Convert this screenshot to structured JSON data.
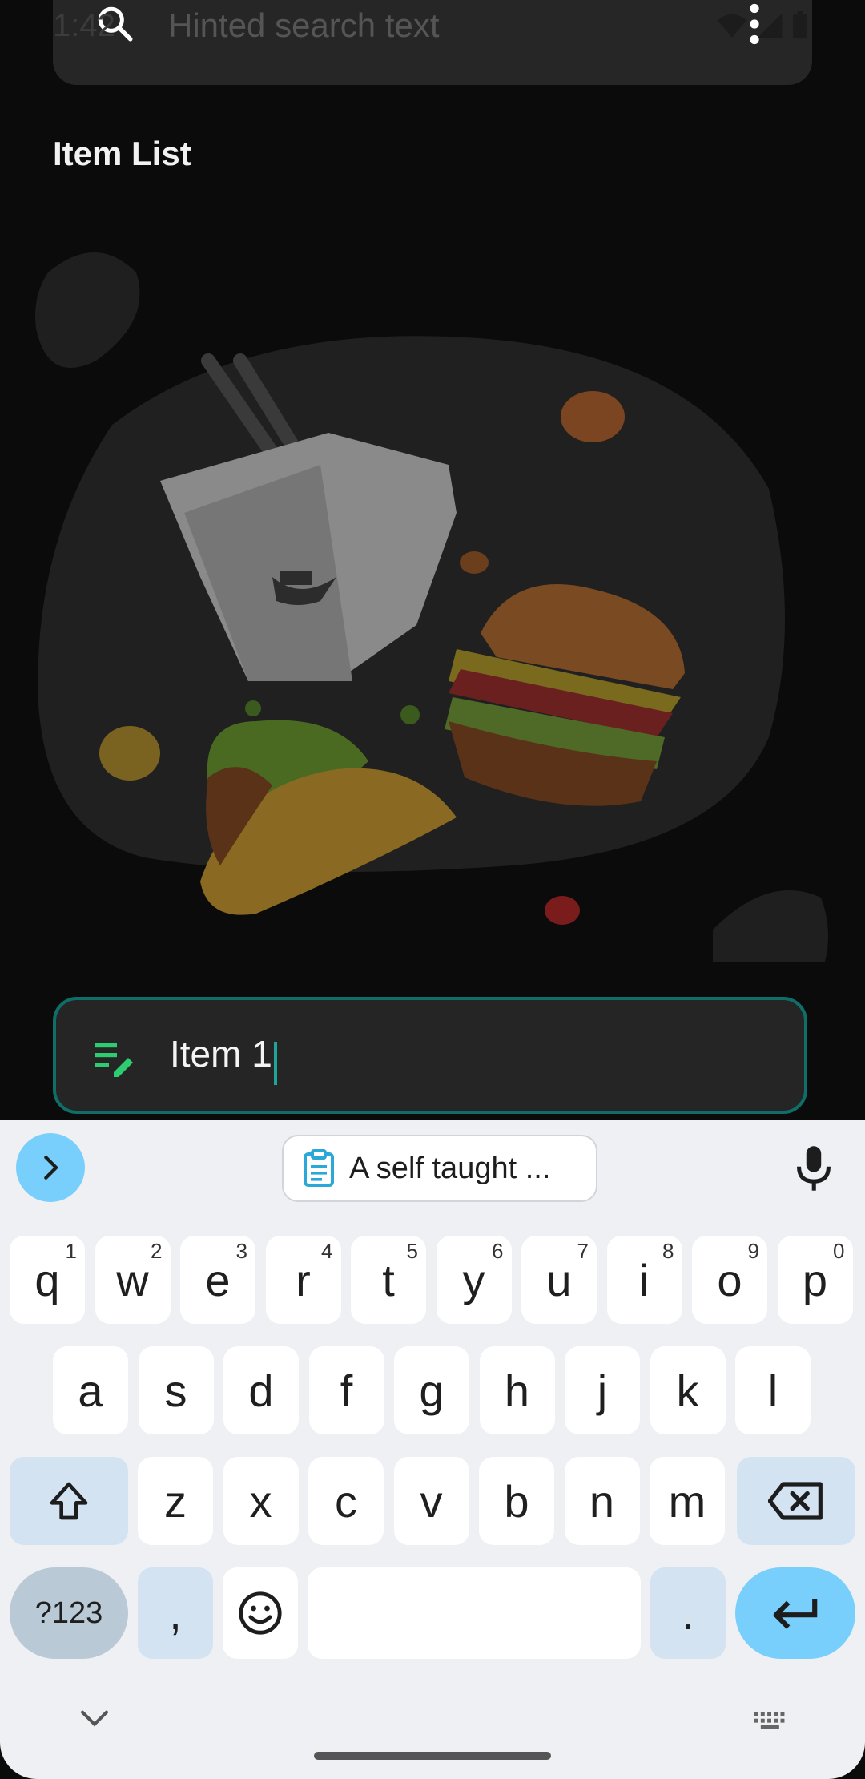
{
  "status_bar": {
    "time": "1:42"
  },
  "search": {
    "placeholder": "Hinted search text"
  },
  "list": {
    "title": "Item List"
  },
  "input": {
    "value": "Item 1"
  },
  "keyboard": {
    "clipboard_suggestion": "A self taught ...",
    "rows": [
      [
        {
          "k": "q",
          "h": "1"
        },
        {
          "k": "w",
          "h": "2"
        },
        {
          "k": "e",
          "h": "3"
        },
        {
          "k": "r",
          "h": "4"
        },
        {
          "k": "t",
          "h": "5"
        },
        {
          "k": "y",
          "h": "6"
        },
        {
          "k": "u",
          "h": "7"
        },
        {
          "k": "i",
          "h": "8"
        },
        {
          "k": "o",
          "h": "9"
        },
        {
          "k": "p",
          "h": "0"
        }
      ],
      [
        {
          "k": "a"
        },
        {
          "k": "s"
        },
        {
          "k": "d"
        },
        {
          "k": "f"
        },
        {
          "k": "g"
        },
        {
          "k": "h"
        },
        {
          "k": "j"
        },
        {
          "k": "k"
        },
        {
          "k": "l"
        }
      ],
      [
        {
          "k": "z"
        },
        {
          "k": "x"
        },
        {
          "k": "c"
        },
        {
          "k": "v"
        },
        {
          "k": "b"
        },
        {
          "k": "n"
        },
        {
          "k": "m"
        }
      ]
    ],
    "symbols_label": "?123",
    "comma": ",",
    "period": "."
  },
  "colors": {
    "accent": "#0e6f68",
    "keyboard_accent": "#79cffb",
    "edit_icon": "#2ecc71"
  }
}
